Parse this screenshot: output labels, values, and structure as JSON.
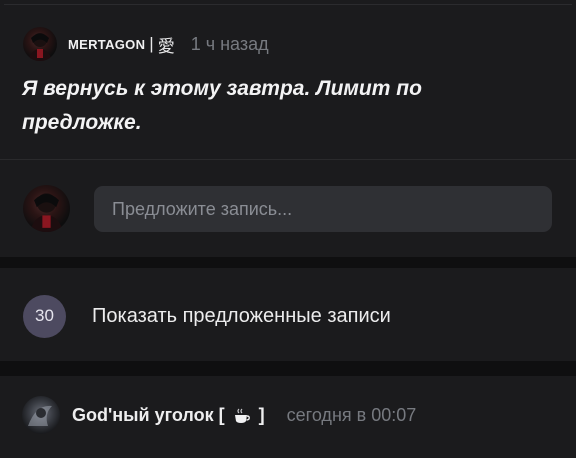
{
  "post": {
    "author_name": "MERTAGON",
    "author_separator": "|",
    "author_kanji": "愛",
    "time": "1 ч назад",
    "text": "Я вернусь к этому завтра. Лимит по предложке."
  },
  "comment": {
    "placeholder": "Предложите запись..."
  },
  "suggested": {
    "count": "30",
    "label": "Показать предложенные записи"
  },
  "post2": {
    "author_prefix": "God'ный уголок [",
    "author_suffix": "]",
    "time": "сегодня в 00:07"
  },
  "icons": {
    "author_avatar": "avatar-icon",
    "user_avatar": "avatar-icon",
    "community_avatar": "avatar-icon",
    "cup": "coffee-cup-icon"
  },
  "colors": {
    "background": "#0f0f10",
    "card": "#1b1b1d",
    "input": "#2f3034",
    "badge": "#4d4a60",
    "muted": "#777a80"
  }
}
